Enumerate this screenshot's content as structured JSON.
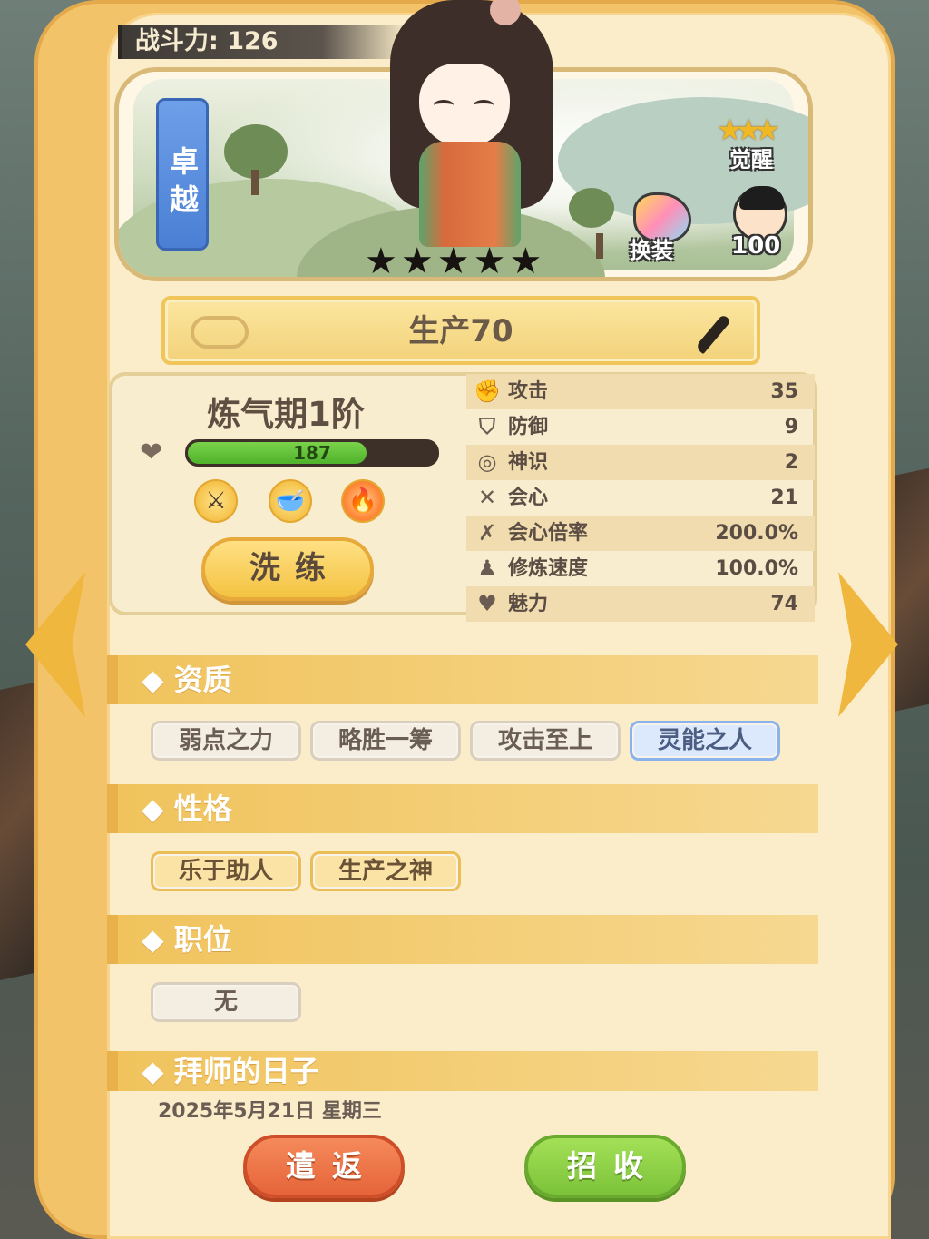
{
  "header": {
    "power_label": "战斗力:",
    "power_value": "126"
  },
  "portrait": {
    "rank_text": "卓越",
    "stars": [
      "★",
      "★",
      "★",
      "★",
      "★"
    ],
    "awaken": {
      "stars": "★★★",
      "label": "觉醒"
    },
    "costume_label": "换装",
    "avatar_count": "100"
  },
  "banner": {
    "text": "生产70"
  },
  "status": {
    "realm": "炼气期1阶",
    "hp_value": "187",
    "hp_fraction": 0.72,
    "skills": [
      {
        "icon": "sword-icon",
        "glyph": "⚔"
      },
      {
        "icon": "bowl-icon",
        "glyph": "🥣"
      },
      {
        "icon": "fire-icon",
        "glyph": "🔥"
      }
    ],
    "wash_label": "洗练"
  },
  "stats": [
    {
      "icon": "fist-icon",
      "glyph": "✊",
      "name": "攻击",
      "value": "35"
    },
    {
      "icon": "shield-icon",
      "glyph": "⛉",
      "name": "防御",
      "value": "9"
    },
    {
      "icon": "spirit-icon",
      "glyph": "◎",
      "name": "神识",
      "value": "2"
    },
    {
      "icon": "cross-swords-icon",
      "glyph": "✕",
      "name": "会心",
      "value": "21"
    },
    {
      "icon": "crit-rate-icon",
      "glyph": "✗",
      "name": "会心倍率",
      "value": "200.0%"
    },
    {
      "icon": "meditate-icon",
      "glyph": "♟",
      "name": "修炼速度",
      "value": "100.0%"
    },
    {
      "icon": "heart-icon",
      "glyph": "♥",
      "name": "魅力",
      "value": "74"
    }
  ],
  "sections": {
    "aptitude": {
      "title": "◆ 资质",
      "chips": [
        "弱点之力",
        "略胜一筹",
        "攻击至上",
        "灵能之人"
      ]
    },
    "personality": {
      "title": "◆ 性格",
      "chips": [
        "乐于助人",
        "生产之神"
      ]
    },
    "position": {
      "title": "◆ 职位",
      "chips": [
        "无"
      ]
    },
    "apprentice": {
      "title": "◆ 拜师的日子",
      "date": "2025年5月21日 星期三"
    }
  },
  "actions": {
    "dismiss_label": "遣返",
    "recruit_label": "招收"
  },
  "colors": {
    "card": "#f3c36a",
    "panel": "#fbedc9",
    "hp_green": "#4fb32b",
    "dismiss_red": "#e6643a",
    "recruit_green": "#7cc33a",
    "rank_blue": "#4a7fd4"
  }
}
